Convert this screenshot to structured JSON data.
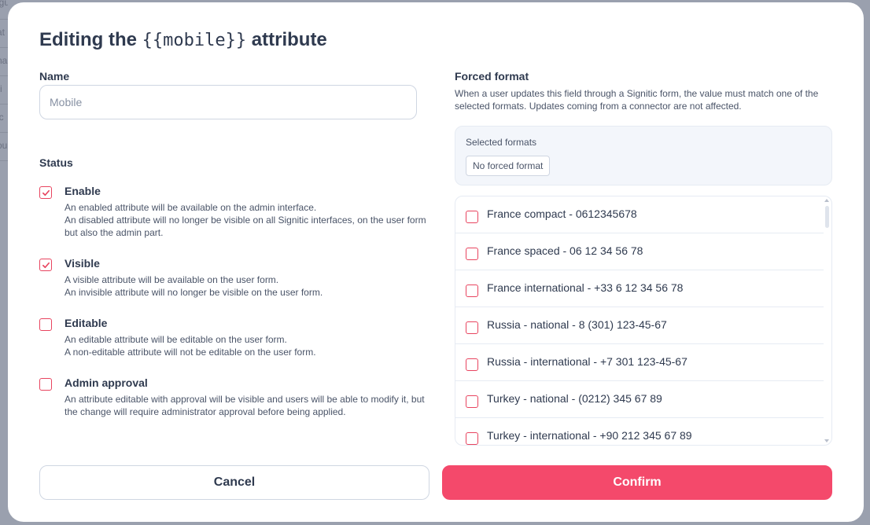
{
  "backdrop": {
    "fragments": [
      "igu",
      "at",
      "na",
      "ri",
      "ic",
      "ou"
    ]
  },
  "modal": {
    "title_prefix": "Editing the",
    "title_code": "{{mobile}}",
    "title_suffix": "attribute"
  },
  "name": {
    "label": "Name",
    "placeholder": "Mobile",
    "value": ""
  },
  "status": {
    "label": "Status",
    "items": [
      {
        "title": "Enable",
        "checked": true,
        "lines": [
          "An enabled attribute will be available on the admin interface.",
          "An disabled attribute will no longer be visible on all Signitic interfaces, on the user form but also the admin part."
        ]
      },
      {
        "title": "Visible",
        "checked": true,
        "lines": [
          "A visible attribute will be available on the user form.",
          "An invisible attribute will no longer be visible on the user form."
        ]
      },
      {
        "title": "Editable",
        "checked": false,
        "lines": [
          "An editable attribute will be editable on the user form.",
          "A non-editable attribute will not be editable on the user form."
        ]
      },
      {
        "title": "Admin approval",
        "checked": false,
        "lines": [
          "An attribute editable with approval will be visible and users will be able to modify it, but the change will require administrator approval before being applied."
        ]
      }
    ]
  },
  "forced_format": {
    "label": "Forced format",
    "description": "When a user updates this field through a Signitic form, the value must match one of the selected formats. Updates coming from a connector are not affected.",
    "selected_label": "Selected formats",
    "selected_chip": "No forced format",
    "options": [
      {
        "label": "France compact - 0612345678",
        "checked": false
      },
      {
        "label": "France spaced - 06 12 34 56 78",
        "checked": false
      },
      {
        "label": "France international - +33 6 12 34 56 78",
        "checked": false
      },
      {
        "label": "Russia - national - 8 (301) 123-45-67",
        "checked": false
      },
      {
        "label": "Russia - international - +7 301 123-45-67",
        "checked": false
      },
      {
        "label": "Turkey - national - (0212) 345 67 89",
        "checked": false
      },
      {
        "label": "Turkey - international - +90 212 345 67 89",
        "checked": false
      }
    ]
  },
  "actions": {
    "cancel_label": "Cancel",
    "confirm_label": "Confirm"
  },
  "colors": {
    "accent": "#f4496b",
    "checkbox": "#e8445f",
    "text": "#2f3a4f"
  }
}
